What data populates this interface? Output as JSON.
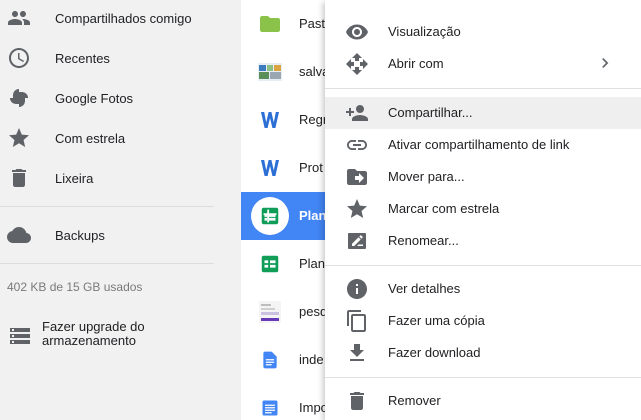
{
  "sidebar": {
    "items": [
      {
        "label": "Compartilhados comigo",
        "icon": "people-icon"
      },
      {
        "label": "Recentes",
        "icon": "clock-icon"
      },
      {
        "label": "Google Fotos",
        "icon": "pinwheel-icon"
      },
      {
        "label": "Com estrela",
        "icon": "star-icon"
      },
      {
        "label": "Lixeira",
        "icon": "trash-icon"
      },
      {
        "label": "Backups",
        "icon": "cloud-icon"
      }
    ],
    "storage_text": "402 KB de 15 GB usados",
    "upgrade_label": "Fazer upgrade do armazenamento"
  },
  "files": [
    {
      "name": "Past",
      "icon": "folder-icon"
    },
    {
      "name": "salva",
      "icon": "image-thumbnail"
    },
    {
      "name": "Regr",
      "icon": "word-icon"
    },
    {
      "name": "Prot",
      "icon": "word-icon"
    },
    {
      "name": "Plan",
      "icon": "sheets-icon",
      "selected": true
    },
    {
      "name": "Plan",
      "icon": "sheets-icon"
    },
    {
      "name": "pesq",
      "icon": "form-thumbnail"
    },
    {
      "name": "inde",
      "icon": "docs-icon"
    },
    {
      "name": "Impo",
      "icon": "docs-icon"
    }
  ],
  "menu": {
    "items": [
      {
        "label": "Visualização",
        "icon": "eye-icon"
      },
      {
        "label": "Abrir com",
        "icon": "move-arrows-icon",
        "submenu": true
      },
      {
        "label": "Compartilhar...",
        "icon": "add-person-icon",
        "hovered": true
      },
      {
        "label": "Ativar compartilhamento de link",
        "icon": "link-icon"
      },
      {
        "label": "Mover para...",
        "icon": "folder-move-icon"
      },
      {
        "label": "Marcar com estrela",
        "icon": "star-icon"
      },
      {
        "label": "Renomear...",
        "icon": "rename-icon"
      },
      {
        "label": "Ver detalhes",
        "icon": "info-icon"
      },
      {
        "label": "Fazer uma cópia",
        "icon": "copy-icon"
      },
      {
        "label": "Fazer download",
        "icon": "download-icon"
      },
      {
        "label": "Remover",
        "icon": "trash-icon"
      }
    ]
  },
  "colors": {
    "sidebar_bg": "#f1f1f1",
    "selected_bg": "#4285f4",
    "folder_green": "#8bc34a",
    "sheets_green": "#0f9d58",
    "docs_blue": "#4285f4",
    "icon_gray": "#5f6368"
  }
}
